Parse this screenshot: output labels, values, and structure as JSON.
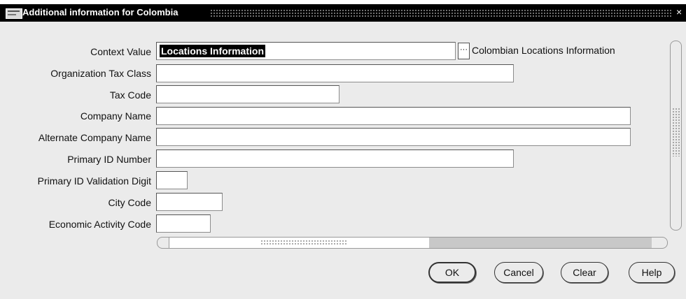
{
  "window": {
    "title": "Additional information for Colombia",
    "close_glyph": "×"
  },
  "icons": {
    "system_menu": "app-menu-icon",
    "lov": "ellipsis-icon"
  },
  "form": {
    "context_label": "Context Value",
    "context_value": "Locations Information",
    "lov_glyph": "···",
    "context_description": "Colombian Locations Information",
    "fields": [
      {
        "label": "Organization Tax Class",
        "value": ""
      },
      {
        "label": "Tax Code",
        "value": ""
      },
      {
        "label": "Company Name",
        "value": ""
      },
      {
        "label": "Alternate Company Name",
        "value": ""
      },
      {
        "label": "Primary ID Number",
        "value": ""
      },
      {
        "label": "Primary ID Validation Digit",
        "value": ""
      },
      {
        "label": "City Code",
        "value": ""
      },
      {
        "label": "Economic Activity Code",
        "value": ""
      }
    ]
  },
  "buttons": {
    "ok": "OK",
    "cancel": "Cancel",
    "clear": "Clear",
    "help": "Help"
  }
}
